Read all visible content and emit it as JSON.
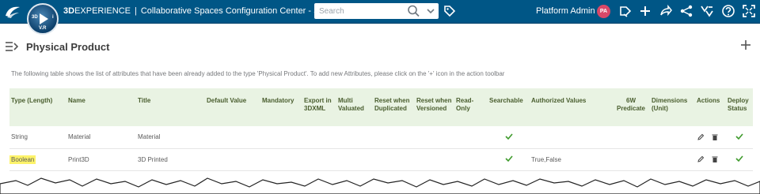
{
  "topbar": {
    "brand_3d": "3D",
    "brand_experience": "EXPERIENCE",
    "brand_separator": "|",
    "app_title": "Collaborative Spaces Configuration Center - SOL...",
    "compass_version": "V.R",
    "compass_3d": "3D",
    "compass_i": "i",
    "search_placeholder": "Search",
    "user_name": "Platform Admin",
    "user_initials": "PA",
    "avatar_color": "#d94868",
    "bar_color": "#005686",
    "icons": [
      "search-icon",
      "caret-icon",
      "tag-icon",
      "share-icon",
      "plus-icon",
      "forward-icon",
      "network-icon",
      "apps-icon",
      "help-icon",
      "expand-icon"
    ]
  },
  "header": {
    "title": "Physical Product",
    "description": "The following table shows the list of attributes that have been already added to the type 'Physical Product'. To add new Attributes, please click on the '+' icon in the action toolbar"
  },
  "table": {
    "columns": [
      "Type (Length)",
      "Name",
      "Title",
      "Default Value",
      "Mandatory",
      "Export in 3DXML",
      "Multi Valuated",
      "Reset when Duplicated",
      "Reset when Versioned",
      "Read-Only",
      "Searchable",
      "Authorized Values",
      "6W Predicate",
      "Dimensions (Unit)",
      "Actions",
      "Deploy Status"
    ],
    "rows": [
      {
        "type": "String",
        "name": "Material",
        "title": "Material",
        "default_value": "",
        "mandatory": "",
        "export": "",
        "multi": "",
        "reset_dup": "",
        "reset_ver": "",
        "read_only": "",
        "searchable": true,
        "authorized_values": "",
        "predicate": "",
        "dimensions": "",
        "deploy_status": true,
        "highlighted": false
      },
      {
        "type": "Boolean",
        "name": "Print3D",
        "title": "3D Printed",
        "default_value": "",
        "mandatory": "",
        "export": "",
        "multi": "",
        "reset_dup": "",
        "reset_ver": "",
        "read_only": "",
        "searchable": true,
        "authorized_values": "True,False",
        "predicate": "",
        "dimensions": "",
        "deploy_status": true,
        "highlighted": true
      }
    ]
  },
  "colors": {
    "header_bg": "#e9f3e3",
    "header_text": "#4a5e2f",
    "check_green": "#3f9b2d",
    "highlight": "#fdf36a"
  }
}
